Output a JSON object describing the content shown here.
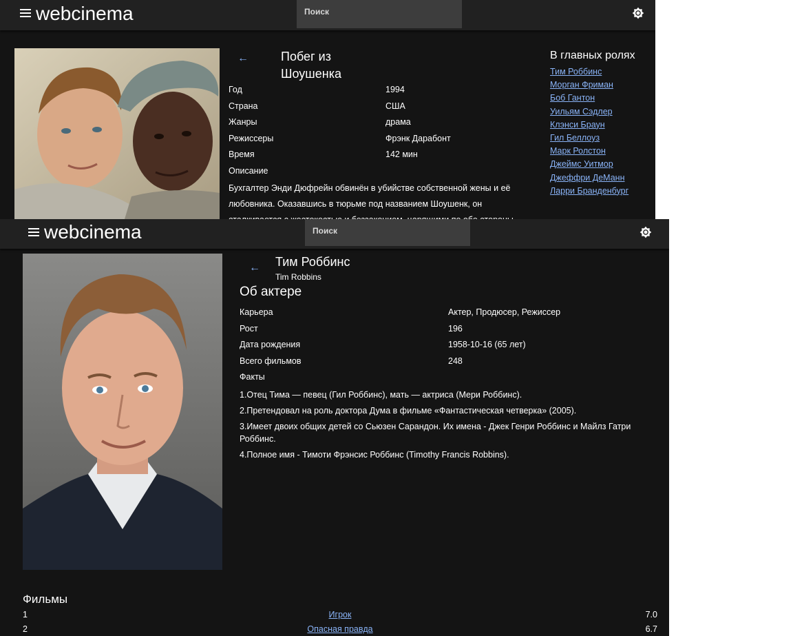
{
  "app": {
    "logo": "webcinema",
    "search_placeholder": "Поиск"
  },
  "movie_page": {
    "title": "Побег из Шоушенка",
    "details": [
      {
        "label": "Год",
        "value": "1994"
      },
      {
        "label": "Страна",
        "value": "США"
      },
      {
        "label": "Жанры",
        "value": "драма"
      },
      {
        "label": "Режиссеры",
        "value": "Фрэнк Дарабонт"
      },
      {
        "label": "Время",
        "value": "142 мин"
      },
      {
        "label": "Описание",
        "value": ""
      }
    ],
    "description": "Бухгалтер Энди Дюфрейн обвинён в убийстве собственной жены и её любовника. Оказавшись в тюрьме под названием Шоушенк, он сталкивается с жестокостью и беззаконием, царящими по обе стороны",
    "cast_heading": "В главных ролях",
    "cast": [
      "Тим Роббинс",
      "Морган Фриман",
      "Боб Гантон",
      "Уильям Сэдлер",
      "Клэнси Браун",
      "Гил Беллоуз",
      "Марк Ролстон",
      "Джеймс Уитмор",
      "Джеффри ДеМанн",
      "Ларри Бранденбург"
    ]
  },
  "actor_page": {
    "name": "Тим Роббинс",
    "original_name": "Tim Robbins",
    "about_heading": "Об актере",
    "details": [
      {
        "label": "Карьера",
        "value": "Актер, Продюсер, Режиссер"
      },
      {
        "label": "Рост",
        "value": "196"
      },
      {
        "label": "Дата рождения",
        "value": "1958-10-16 (65 лет)"
      },
      {
        "label": "Всего фильмов",
        "value": "248"
      },
      {
        "label": "Факты",
        "value": ""
      }
    ],
    "facts": [
      "1.Отец Тима — певец (Гил Роббинс), мать — актриса (Мери Роббинс).",
      "2.Претендовал на роль доктора Дума в фильме «Фантастическая четверка» (2005).",
      "3.Имеет двоих общих детей со Сьюзен Сарандон. Их имена - Джек Генри Роббинс и Майлз Гатри Роббинс.",
      "4.Полное имя - Тимоти Фрэнсис Роббинс (Timothy Francis Robbins)."
    ],
    "films_heading": "Фильмы",
    "films": [
      {
        "num": "1",
        "title": "Игрок",
        "rating": "7.0"
      },
      {
        "num": "2",
        "title": "Опасная правда",
        "rating": "6.7"
      }
    ]
  },
  "icons": {
    "menu": "hamburger-menu-icon",
    "theme": "brightness-icon",
    "back": "arrow-left-icon"
  },
  "colors": {
    "background": "#141414",
    "appbar": "#212121",
    "search": "#3d3d3d",
    "link": "#8ab4f8"
  }
}
